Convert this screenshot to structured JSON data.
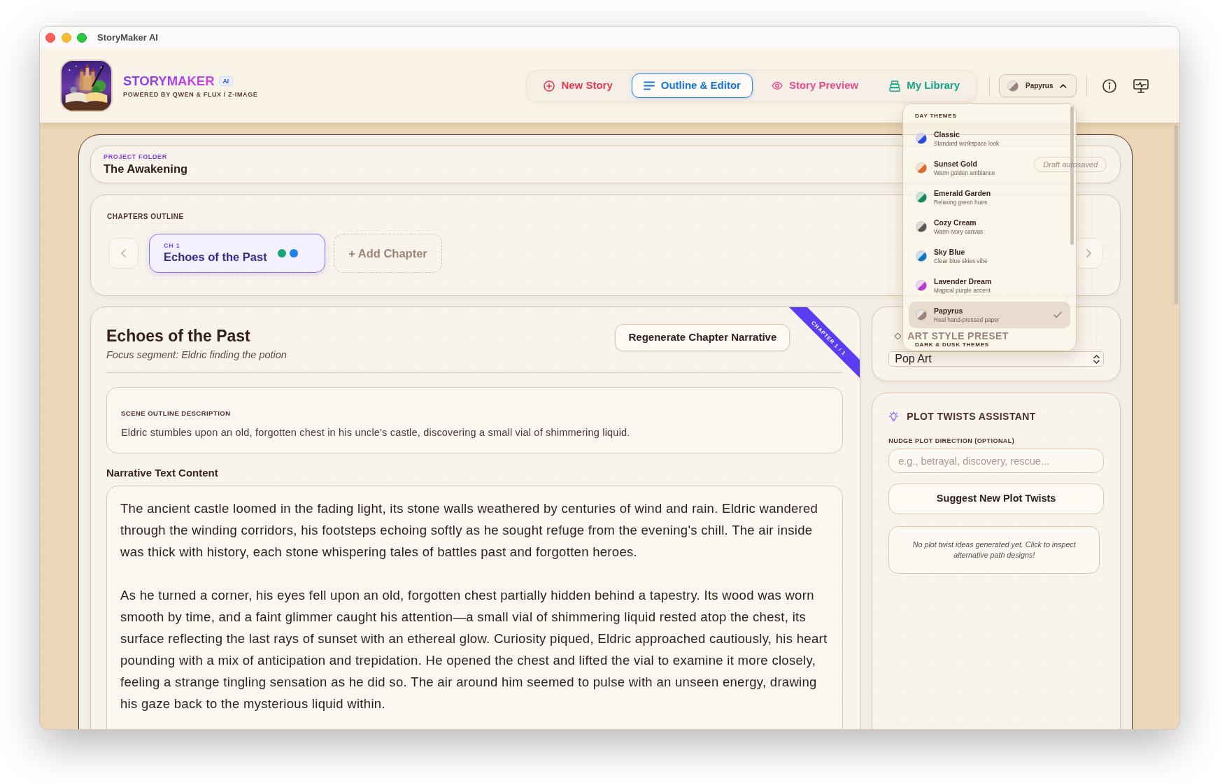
{
  "window": {
    "title": "StoryMaker AI"
  },
  "header": {
    "brand": {
      "name": "STORYMAKER",
      "badge": "AI",
      "tagline": "POWERED BY QWEN & FLUX / Z-IMAGE"
    },
    "nav_tabs": [
      {
        "label": "New Story",
        "color": "#e7384f",
        "selected": false
      },
      {
        "label": "Outline & Editor",
        "color": "#1576e0",
        "selected": true
      },
      {
        "label": "Story Preview",
        "color": "#eb4a8b",
        "selected": false
      },
      {
        "label": "My Library",
        "color": "#14a48a",
        "selected": false
      }
    ],
    "theme_button": {
      "label": "Papyrus",
      "color": "#9b827a",
      "expanded": true
    }
  },
  "theme_menu": {
    "sections": [
      {
        "heading": "DAY THEMES",
        "items": [
          {
            "name": "Classic",
            "description": "Standard workspace look",
            "color": "#2f48d9",
            "selected": false
          },
          {
            "name": "Sunset Gold",
            "description": "Warm golden ambiance",
            "color": "#e2692a",
            "selected": false
          },
          {
            "name": "Emerald Garden",
            "description": "Relaxing green hues",
            "color": "#0f8a5f",
            "selected": false
          },
          {
            "name": "Cozy Cream",
            "description": "Warm ivory canvas",
            "color": "#5e5551",
            "selected": false
          },
          {
            "name": "Sky Blue",
            "description": "Clear blue skies vibe",
            "color": "#0b79c2",
            "selected": false
          },
          {
            "name": "Lavender Dream",
            "description": "Magical purple accent",
            "color": "#b83bd1",
            "selected": false
          },
          {
            "name": "Papyrus",
            "description": "Real hand-pressed paper",
            "color": "#9b827a",
            "selected": true
          }
        ]
      },
      {
        "heading": "DARK & DUSK THEMES"
      }
    ]
  },
  "project": {
    "label": "PROJECT FOLDER",
    "name": "The Awakening",
    "save_status": "Draft autosaved"
  },
  "chapters_outline": {
    "heading": "CHAPTERS OUTLINE",
    "chapters": [
      {
        "number": "CH 1",
        "title": "Echoes of the Past",
        "selected": true,
        "status_dots": [
          {
            "color": "#16a672"
          },
          {
            "color": "#1c80f2"
          }
        ]
      }
    ],
    "add_label": "+ Add Chapter"
  },
  "editor": {
    "title": "Echoes of the Past",
    "focus": "Focus segment: Eldric finding the potion",
    "regenerate_button": "Regenerate Chapter Narrative",
    "ribbon": "CHAPTER 1 / 1",
    "scene_outline": {
      "label": "SCENE OUTLINE DESCRIPTION",
      "text": "Eldric stumbles upon an old, forgotten chest in his uncle's castle, discovering a small vial of shimmering liquid."
    },
    "narrative": {
      "label": "Narrative Text Content",
      "paragraphs": [
        "The ancient castle loomed in the fading light, its stone walls weathered by centuries of wind and rain. Eldric wandered through the winding corridors, his footsteps echoing softly as he sought refuge from the evening's chill. The air inside was thick with history, each stone whispering tales of battles past and forgotten heroes.",
        "As he turned a corner, his eyes fell upon an old, forgotten chest partially hidden behind a tapestry. Its wood was worn smooth by time, and a faint glimmer caught his attention—a small vial of shimmering liquid rested atop the chest, its surface reflecting the last rays of sunset with an ethereal glow. Curiosity piqued, Eldric approached cautiously, his heart pounding with a mix of anticipation and trepidation. He opened the chest and lifted the vial to examine it more closely, feeling a strange tingling sensation as he did so. The air around him seemed to pulse with an unseen energy, drawing his gaze back to the mysterious liquid within."
      ]
    }
  },
  "art_style": {
    "label": "ART STYLE PRESET",
    "value": "Pop Art"
  },
  "plot_twists": {
    "title": "PLOT TWISTS ASSISTANT",
    "input_label": "NUDGE PLOT DIRECTION (OPTIONAL)",
    "placeholder": "e.g., betrayal, discovery, rescue...",
    "button": "Suggest New Plot Twists",
    "empty_message": "No plot twist ideas generated yet. Click to inspect alternative path designs!"
  }
}
